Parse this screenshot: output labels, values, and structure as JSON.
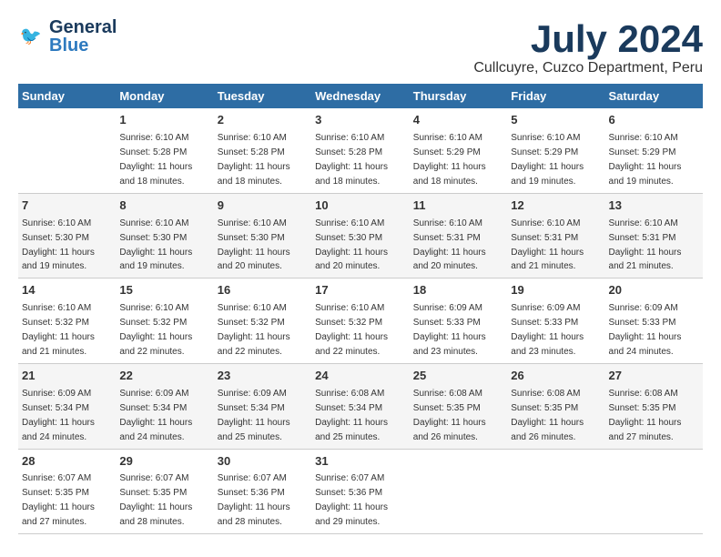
{
  "header": {
    "logo_line1": "General",
    "logo_line2": "Blue",
    "month": "July 2024",
    "location": "Cullcuyre, Cuzco Department, Peru"
  },
  "days_of_week": [
    "Sunday",
    "Monday",
    "Tuesday",
    "Wednesday",
    "Thursday",
    "Friday",
    "Saturday"
  ],
  "weeks": [
    [
      {
        "day": "",
        "info": ""
      },
      {
        "day": "1",
        "info": "Sunrise: 6:10 AM\nSunset: 5:28 PM\nDaylight: 11 hours\nand 18 minutes."
      },
      {
        "day": "2",
        "info": "Sunrise: 6:10 AM\nSunset: 5:28 PM\nDaylight: 11 hours\nand 18 minutes."
      },
      {
        "day": "3",
        "info": "Sunrise: 6:10 AM\nSunset: 5:28 PM\nDaylight: 11 hours\nand 18 minutes."
      },
      {
        "day": "4",
        "info": "Sunrise: 6:10 AM\nSunset: 5:29 PM\nDaylight: 11 hours\nand 18 minutes."
      },
      {
        "day": "5",
        "info": "Sunrise: 6:10 AM\nSunset: 5:29 PM\nDaylight: 11 hours\nand 19 minutes."
      },
      {
        "day": "6",
        "info": "Sunrise: 6:10 AM\nSunset: 5:29 PM\nDaylight: 11 hours\nand 19 minutes."
      }
    ],
    [
      {
        "day": "7",
        "info": "Sunrise: 6:10 AM\nSunset: 5:30 PM\nDaylight: 11 hours\nand 19 minutes."
      },
      {
        "day": "8",
        "info": "Sunrise: 6:10 AM\nSunset: 5:30 PM\nDaylight: 11 hours\nand 19 minutes."
      },
      {
        "day": "9",
        "info": "Sunrise: 6:10 AM\nSunset: 5:30 PM\nDaylight: 11 hours\nand 20 minutes."
      },
      {
        "day": "10",
        "info": "Sunrise: 6:10 AM\nSunset: 5:30 PM\nDaylight: 11 hours\nand 20 minutes."
      },
      {
        "day": "11",
        "info": "Sunrise: 6:10 AM\nSunset: 5:31 PM\nDaylight: 11 hours\nand 20 minutes."
      },
      {
        "day": "12",
        "info": "Sunrise: 6:10 AM\nSunset: 5:31 PM\nDaylight: 11 hours\nand 21 minutes."
      },
      {
        "day": "13",
        "info": "Sunrise: 6:10 AM\nSunset: 5:31 PM\nDaylight: 11 hours\nand 21 minutes."
      }
    ],
    [
      {
        "day": "14",
        "info": "Sunrise: 6:10 AM\nSunset: 5:32 PM\nDaylight: 11 hours\nand 21 minutes."
      },
      {
        "day": "15",
        "info": "Sunrise: 6:10 AM\nSunset: 5:32 PM\nDaylight: 11 hours\nand 22 minutes."
      },
      {
        "day": "16",
        "info": "Sunrise: 6:10 AM\nSunset: 5:32 PM\nDaylight: 11 hours\nand 22 minutes."
      },
      {
        "day": "17",
        "info": "Sunrise: 6:10 AM\nSunset: 5:32 PM\nDaylight: 11 hours\nand 22 minutes."
      },
      {
        "day": "18",
        "info": "Sunrise: 6:09 AM\nSunset: 5:33 PM\nDaylight: 11 hours\nand 23 minutes."
      },
      {
        "day": "19",
        "info": "Sunrise: 6:09 AM\nSunset: 5:33 PM\nDaylight: 11 hours\nand 23 minutes."
      },
      {
        "day": "20",
        "info": "Sunrise: 6:09 AM\nSunset: 5:33 PM\nDaylight: 11 hours\nand 24 minutes."
      }
    ],
    [
      {
        "day": "21",
        "info": "Sunrise: 6:09 AM\nSunset: 5:34 PM\nDaylight: 11 hours\nand 24 minutes."
      },
      {
        "day": "22",
        "info": "Sunrise: 6:09 AM\nSunset: 5:34 PM\nDaylight: 11 hours\nand 24 minutes."
      },
      {
        "day": "23",
        "info": "Sunrise: 6:09 AM\nSunset: 5:34 PM\nDaylight: 11 hours\nand 25 minutes."
      },
      {
        "day": "24",
        "info": "Sunrise: 6:08 AM\nSunset: 5:34 PM\nDaylight: 11 hours\nand 25 minutes."
      },
      {
        "day": "25",
        "info": "Sunrise: 6:08 AM\nSunset: 5:35 PM\nDaylight: 11 hours\nand 26 minutes."
      },
      {
        "day": "26",
        "info": "Sunrise: 6:08 AM\nSunset: 5:35 PM\nDaylight: 11 hours\nand 26 minutes."
      },
      {
        "day": "27",
        "info": "Sunrise: 6:08 AM\nSunset: 5:35 PM\nDaylight: 11 hours\nand 27 minutes."
      }
    ],
    [
      {
        "day": "28",
        "info": "Sunrise: 6:07 AM\nSunset: 5:35 PM\nDaylight: 11 hours\nand 27 minutes."
      },
      {
        "day": "29",
        "info": "Sunrise: 6:07 AM\nSunset: 5:35 PM\nDaylight: 11 hours\nand 28 minutes."
      },
      {
        "day": "30",
        "info": "Sunrise: 6:07 AM\nSunset: 5:36 PM\nDaylight: 11 hours\nand 28 minutes."
      },
      {
        "day": "31",
        "info": "Sunrise: 6:07 AM\nSunset: 5:36 PM\nDaylight: 11 hours\nand 29 minutes."
      },
      {
        "day": "",
        "info": ""
      },
      {
        "day": "",
        "info": ""
      },
      {
        "day": "",
        "info": ""
      }
    ]
  ]
}
